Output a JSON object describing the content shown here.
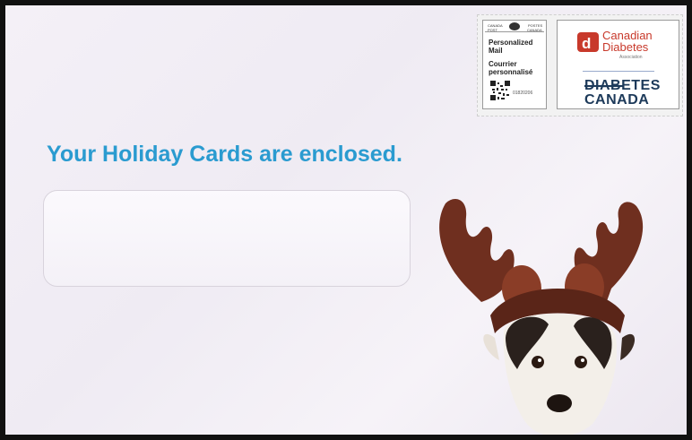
{
  "envelope": {
    "headline": "Your Holiday Cards are enclosed."
  },
  "canada_post_stamp": {
    "header_left": "CANADA",
    "header_right": "POSTES",
    "header_left2": "POST",
    "header_right2": "CANADA",
    "label_en": "Personalized\nMail",
    "label_fr": "Courrier\npersonnalisé",
    "code": "01820206"
  },
  "charity_stamp": {
    "logo_letter": "d",
    "name": "Canadian\nDiabetes",
    "subtitle": "Association",
    "new_name_line1": "DIABETES",
    "new_name_line2": "CANADA"
  },
  "colors": {
    "headline": "#2a9bd0",
    "cda_red": "#c8392b",
    "dc_navy": "#1d3a5a"
  },
  "icons": {
    "qr": "qr-code-icon",
    "post_logo": "canada-post-logo-icon",
    "dog": "reindeer-antler-dog-image"
  }
}
